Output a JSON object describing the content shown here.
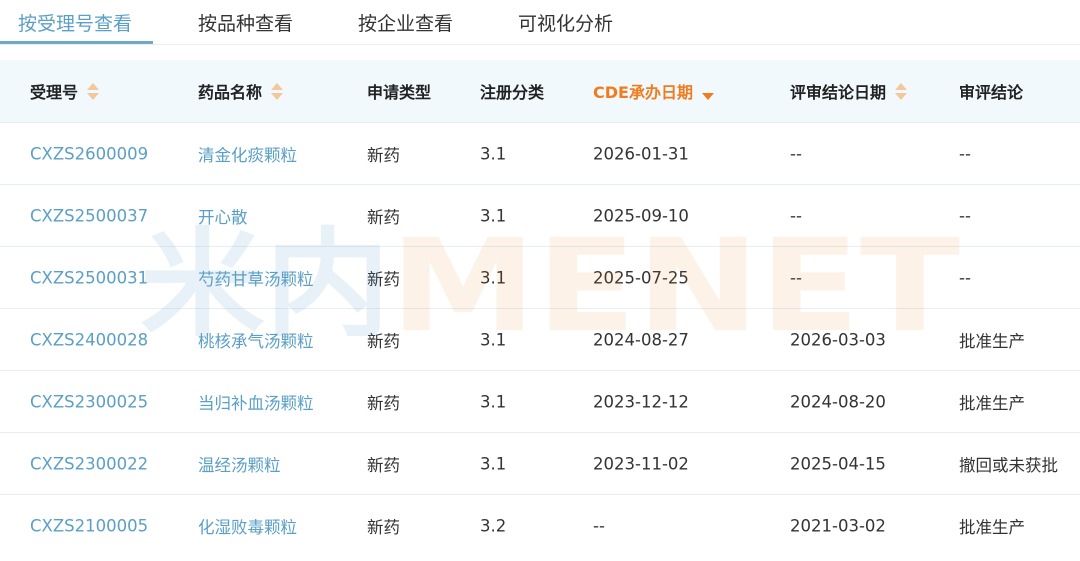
{
  "tabs": [
    {
      "label": "按受理号查看",
      "active": true
    },
    {
      "label": "按品种查看",
      "active": false
    },
    {
      "label": "按企业查看",
      "active": false
    },
    {
      "label": "可视化分析",
      "active": false
    }
  ],
  "table": {
    "headers": [
      {
        "label": "受理号",
        "sortable": true,
        "sorted": false
      },
      {
        "label": "药品名称",
        "sortable": true,
        "sorted": false
      },
      {
        "label": "申请类型",
        "sortable": false,
        "sorted": false
      },
      {
        "label": "注册分类",
        "sortable": false,
        "sorted": false
      },
      {
        "label": "CDE承办日期",
        "sortable": true,
        "sorted": true,
        "sort_direction": "desc"
      },
      {
        "label": "评审结论日期",
        "sortable": true,
        "sorted": false
      },
      {
        "label": "审评结论",
        "sortable": false,
        "sorted": false
      }
    ],
    "rows": [
      [
        "CXZS2600009",
        "清金化痰颗粒",
        "新药",
        "3.1",
        "2026-01-31",
        "--",
        "--"
      ],
      [
        "CXZS2500037",
        "开心散",
        "新药",
        "3.1",
        "2025-09-10",
        "--",
        "--"
      ],
      [
        "CXZS2500031",
        "芍药甘草汤颗粒",
        "新药",
        "3.1",
        "2025-07-25",
        "--",
        "--"
      ],
      [
        "CXZS2400028",
        "桃核承气汤颗粒",
        "新药",
        "3.1",
        "2024-08-27",
        "2026-03-03",
        "批准生产"
      ],
      [
        "CXZS2300025",
        "当归补血汤颗粒",
        "新药",
        "3.1",
        "2023-12-12",
        "2024-08-20",
        "批准生产"
      ],
      [
        "CXZS2300022",
        "温经汤颗粒",
        "新药",
        "3.1",
        "2023-11-02",
        "2025-04-15",
        "撤回或未获批"
      ],
      [
        "CXZS2100005",
        "化湿败毒颗粒",
        "新药",
        "3.2",
        "--",
        "2021-03-02",
        "批准生产"
      ]
    ]
  },
  "watermark": {
    "text_cn": "米内",
    "text_en": "MENET"
  },
  "colors": {
    "accent": "#5a9fc6",
    "sorted_header": "#f07c1f",
    "header_bg": "#f1f9fd",
    "sort_inactive": "#f4c79d"
  }
}
